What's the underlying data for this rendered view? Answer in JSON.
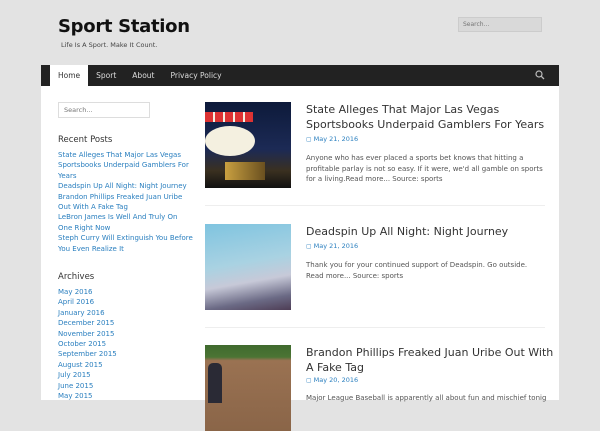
{
  "site": {
    "title": "Sport Station",
    "tagline": "Life Is A Sport. Make It Count.",
    "search_placeholder": "Search..."
  },
  "nav": {
    "items": [
      "Home",
      "Sport",
      "About",
      "Privacy Policy"
    ],
    "active": "Home"
  },
  "sidebar": {
    "search_placeholder": "Search...",
    "recent_title": "Recent Posts",
    "recent": [
      "State Alleges That Major Las Vegas Sportsbooks Underpaid Gamblers For Years",
      "Deadspin Up All Night: Night Journey",
      "Brandon Phillips Freaked Juan Uribe Out With A Fake Tag",
      "LeBron James Is Well And Truly On One Right Now",
      "Steph Curry Will Extinguish You Before You Even Realize It"
    ],
    "archives_title": "Archives",
    "archives": [
      "May 2016",
      "April 2016",
      "January 2016",
      "December 2015",
      "November 2015",
      "October 2015",
      "September 2015",
      "August 2015",
      "July 2015",
      "June 2015",
      "May 2015"
    ]
  },
  "posts": [
    {
      "title": "State Alleges That Major Las Vegas Sportsbooks Underpaid Gamblers For Years",
      "date": "May 21, 2016",
      "excerpt": "Anyone who has ever placed a sports bet knows that hitting a profitable parlay is not so easy. If it were, we'd all gamble on sports for a living.Read more... Source: sports"
    },
    {
      "title": "Deadspin Up All Night: Night Journey",
      "date": "May 21, 2016",
      "excerpt": "Thank you for your continued support of Deadspin. Go outside. Read more... Source: sports"
    },
    {
      "title": "Brandon Phillips Freaked Juan Uribe Out With A Fake Tag",
      "date": "May 20, 2016",
      "excerpt": "Major League Baseball is apparently all about fun and mischief tonight"
    }
  ]
}
